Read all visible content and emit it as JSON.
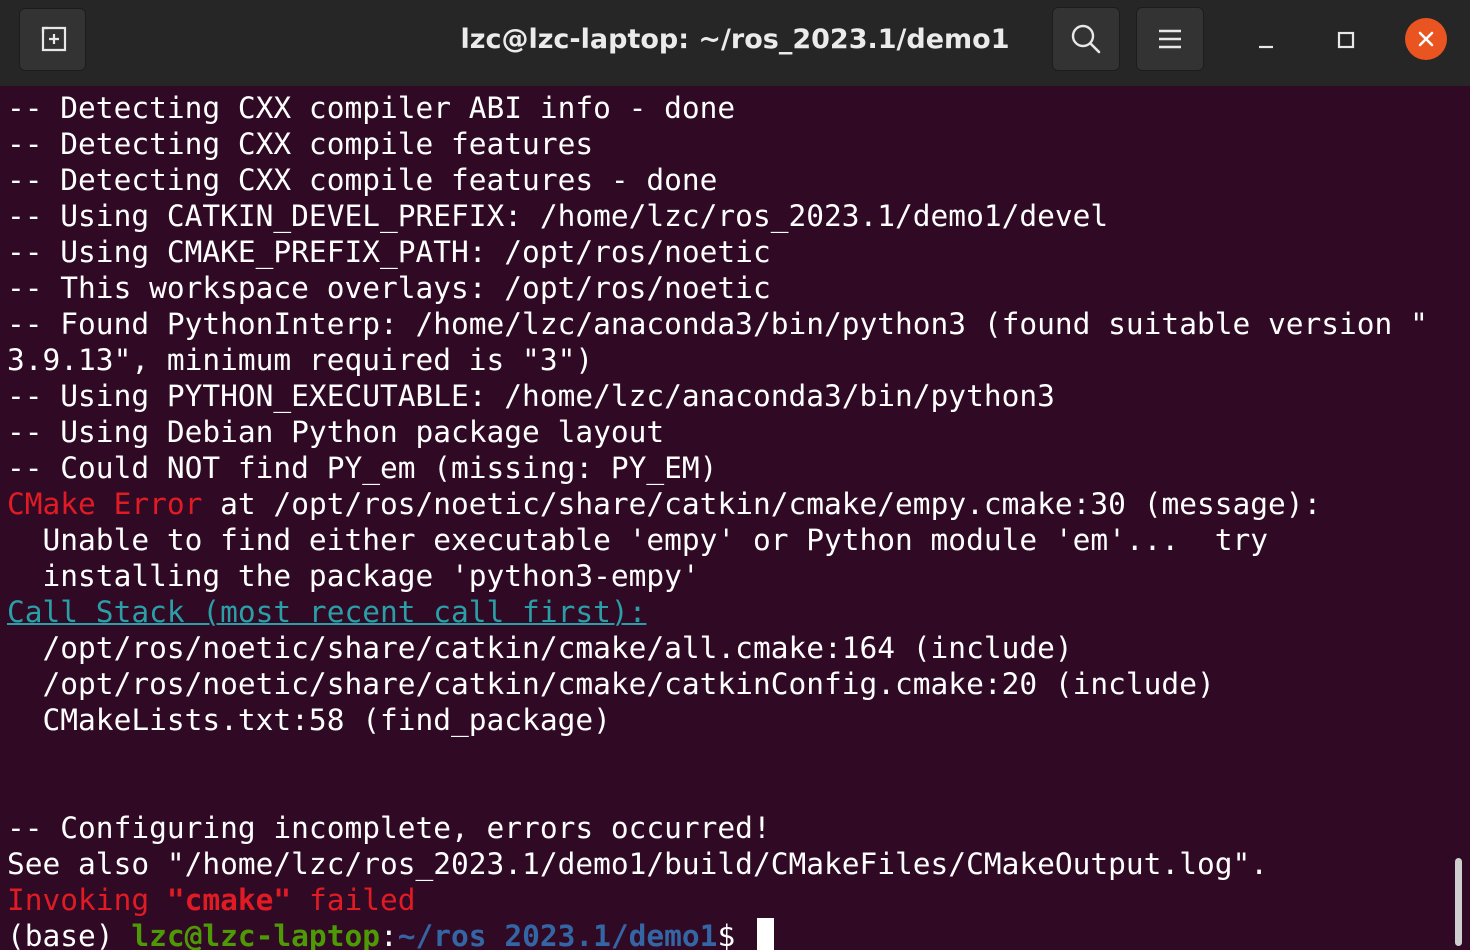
{
  "titlebar": {
    "title": "lzc@lzc-laptop: ~/ros_2023.1/demo1",
    "icons": [
      "new-tab-icon",
      "search-icon",
      "hamburger-menu-icon",
      "minimize-icon",
      "maximize-icon",
      "close-icon"
    ]
  },
  "colors": {
    "background": "#300a24",
    "titlebar": "#262626",
    "error_red": "#e01b24",
    "prompt_green": "#4e9a06",
    "path_blue": "#3465a4",
    "callstack_cyan": "#2a9fa8",
    "close_orange": "#e95420"
  },
  "terminal": {
    "lines": [
      "-- Detecting CXX compiler ABI info - done",
      "-- Detecting CXX compile features",
      "-- Detecting CXX compile features - done",
      "-- Using CATKIN_DEVEL_PREFIX: /home/lzc/ros_2023.1/demo1/devel",
      "-- Using CMAKE_PREFIX_PATH: /opt/ros/noetic",
      "-- This workspace overlays: /opt/ros/noetic",
      "-- Found PythonInterp: /home/lzc/anaconda3/bin/python3 (found suitable version \"",
      "3.9.13\", minimum required is \"3\")",
      "-- Using PYTHON_EXECUTABLE: /home/lzc/anaconda3/bin/python3",
      "-- Using Debian Python package layout",
      "-- Could NOT find PY_em (missing: PY_EM)"
    ],
    "cmake_error": {
      "word1": "CMake",
      "word2": "Error",
      "rest": " at /opt/ros/noetic/share/catkin/cmake/empy.cmake:30 (message):"
    },
    "error_detail": [
      "  Unable to find either executable 'empy' or Python module 'em'...  try",
      "  installing the package 'python3-empy'"
    ],
    "call_stack_header": "Call Stack (most recent call first):",
    "call_stack": [
      "  /opt/ros/noetic/share/catkin/cmake/all.cmake:164 (include)",
      "  /opt/ros/noetic/share/catkin/cmake/catkinConfig.cmake:20 (include)",
      "  CMakeLists.txt:58 (find_package)"
    ],
    "configuring": "-- Configuring incomplete, errors occurred!",
    "see_also": "See also \"/home/lzc/ros_2023.1/demo1/build/CMakeFiles/CMakeOutput.log\".",
    "invoking": {
      "pre": "Invoking ",
      "cmd": "\"cmake\"",
      "post": " failed"
    },
    "prompt": {
      "env": "(base) ",
      "user_host": "lzc@lzc-laptop",
      "colon": ":",
      "path": "~/ros_2023.1/demo1",
      "symbol": "$ "
    }
  }
}
